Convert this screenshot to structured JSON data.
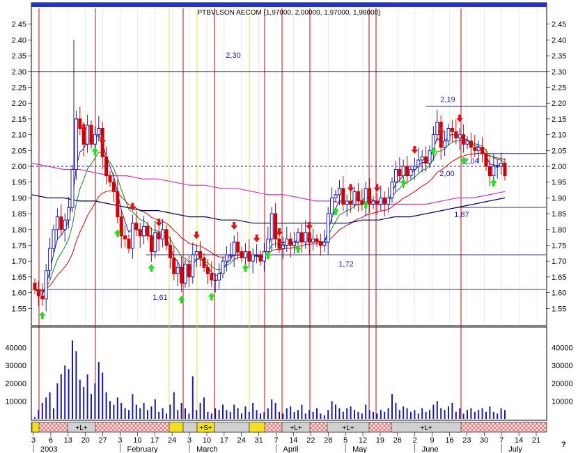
{
  "header": {
    "title": "PTBVLSON AECOM (1,97000, 2,00000, 1,97000, 1,98000)"
  },
  "corner_mark": "?",
  "chart_data": {
    "type": "candlestick",
    "price_axis": {
      "min": 1.5,
      "max": 2.5,
      "ticks": [
        "1.55",
        "1.60",
        "1.65",
        "1.70",
        "1.75",
        "1.80",
        "1.85",
        "1.90",
        "1.95",
        "2.00",
        "2.05",
        "2.10",
        "2.15",
        "2.20",
        "2.25",
        "2.30",
        "2.35",
        "2.40",
        "2.45"
      ]
    },
    "volume_axis": {
      "min": 0,
      "max": 50000,
      "ticks": [
        "10000",
        "20000",
        "30000",
        "40000"
      ]
    },
    "date_ticks": [
      "3",
      "6",
      "13",
      "20",
      "27",
      "3",
      "10",
      "17",
      "24",
      "3",
      "10",
      "17",
      "24",
      "31",
      "7",
      "14",
      "22",
      "28",
      "5",
      "12",
      "19",
      "26",
      "2",
      "9",
      "16",
      "23",
      "30",
      "7",
      "14",
      "21"
    ],
    "month_labels": [
      "2003",
      "February",
      "March",
      "April",
      "May",
      "June",
      "July"
    ],
    "level_lines": [
      {
        "value": 2.3,
        "label": "2,30"
      },
      {
        "value": 2.19,
        "label": "2,19"
      },
      {
        "value": 2.04,
        "label": "2,04"
      },
      {
        "value": 2.0,
        "label": "2,00"
      },
      {
        "value": 1.87,
        "label": "1,87"
      },
      {
        "value": 1.72,
        "label": "1,72"
      },
      {
        "value": 1.61,
        "label": "1,61"
      }
    ],
    "signal_bar_labels": [
      "+L+",
      "+S+",
      "+L+",
      "+L+",
      "+L+"
    ],
    "series": [
      {
        "name": "price",
        "close": [
          1.61,
          1.59,
          1.58,
          1.67,
          1.74,
          1.8,
          1.84,
          1.8,
          1.83,
          1.87,
          1.99,
          2.15,
          2.12,
          2.07,
          2.13,
          2.07,
          2.1,
          2.12,
          2.03,
          1.97,
          1.95,
          1.92,
          1.84,
          1.78,
          1.77,
          1.74,
          1.82,
          1.8,
          1.78,
          1.81,
          1.78,
          1.73,
          1.79,
          1.77,
          1.8,
          1.75,
          1.71,
          1.66,
          1.68,
          1.63,
          1.69,
          1.65,
          1.72,
          1.73,
          1.71,
          1.68,
          1.66,
          1.64,
          1.64,
          1.66,
          1.7,
          1.72,
          1.72,
          1.76,
          1.73,
          1.71,
          1.73,
          1.7,
          1.72,
          1.72,
          1.7,
          1.73,
          1.77,
          1.85,
          1.77,
          1.74,
          1.75,
          1.77,
          1.75,
          1.76,
          1.79,
          1.76,
          1.79,
          1.76,
          1.77,
          1.76,
          1.75,
          1.76,
          1.85,
          1.9,
          1.91,
          1.93,
          1.88,
          1.89,
          1.88,
          1.92,
          1.89,
          1.88,
          1.93,
          1.88,
          1.89,
          1.88,
          1.9,
          1.88,
          1.9,
          1.95,
          1.99,
          1.97,
          2.0,
          1.97,
          1.99,
          2.0,
          2.02,
          2.03,
          2.01,
          2.05,
          2.1,
          2.14,
          2.06,
          2.08,
          2.12,
          2.11,
          2.09,
          2.1,
          2.07,
          2.08,
          2.06,
          2.05,
          2.06,
          2.04,
          2.0,
          1.97,
          2.0,
          2.0,
          2.01,
          1.97
        ]
      },
      {
        "name": "volume",
        "values": [
          1000,
          5000,
          9000,
          12000,
          15000,
          6000,
          20000,
          25000,
          30000,
          28000,
          44000,
          38000,
          22000,
          18000,
          25000,
          14000,
          20000,
          32000,
          26000,
          15000,
          10000,
          8000,
          12000,
          9000,
          6000,
          5000,
          14000,
          8000,
          6000,
          9000,
          5000,
          7000,
          11000,
          4000,
          6000,
          3000,
          8000,
          15000,
          5000,
          9000,
          6000,
          3000,
          24000,
          5000,
          9000,
          12000,
          4000,
          3000,
          6000,
          5000,
          8000,
          5000,
          4000,
          8000,
          6000,
          3000,
          7000,
          4000,
          9000,
          5000,
          3000,
          4000,
          6000,
          11000,
          9000,
          4000,
          3000,
          6000,
          7000,
          4000,
          5000,
          8000,
          3000,
          5000,
          4000,
          6000,
          3000,
          2000,
          5000,
          10000,
          8000,
          6000,
          4000,
          6000,
          7000,
          5000,
          4000,
          3000,
          8000,
          5000,
          4000,
          3000,
          5000,
          4000,
          6000,
          14000,
          9000,
          5000,
          7000,
          6000,
          4000,
          5000,
          3000,
          6000,
          4000,
          5000,
          8000,
          10000,
          6000,
          5000,
          7000,
          9000,
          4000,
          6000,
          3000,
          5000,
          6000,
          4000,
          5000,
          6000,
          4000,
          7000,
          4000,
          3000,
          6000,
          5000
        ]
      },
      {
        "name": "slow-average",
        "values": [
          2.01,
          2.0,
          1.99,
          1.99,
          1.98,
          1.97,
          1.97,
          1.96,
          1.96,
          1.95,
          1.94,
          1.94,
          1.93,
          1.93,
          1.92,
          1.91,
          1.91,
          1.9,
          1.89,
          1.89,
          1.88,
          1.88,
          1.88,
          1.88,
          1.88,
          1.88,
          1.89,
          1.9,
          1.9,
          1.91,
          1.92
        ]
      },
      {
        "name": "long-average",
        "values": [
          1.91,
          1.9,
          1.9,
          1.89,
          1.89,
          1.88,
          1.87,
          1.86,
          1.86,
          1.85,
          1.84,
          1.84,
          1.83,
          1.83,
          1.82,
          1.82,
          1.82,
          1.82,
          1.82,
          1.82,
          1.82,
          1.83,
          1.83,
          1.84,
          1.84,
          1.85,
          1.86,
          1.87,
          1.88,
          1.89,
          1.9
        ]
      }
    ],
    "buy_arrow_indices": [
      2,
      16,
      22,
      31,
      39,
      47,
      56,
      62,
      70,
      80,
      88,
      98,
      106,
      114,
      122
    ],
    "sell_arrow_indices": [
      13,
      18,
      26,
      33,
      43,
      53,
      59,
      65,
      73,
      84,
      91,
      101,
      108,
      113
    ]
  }
}
